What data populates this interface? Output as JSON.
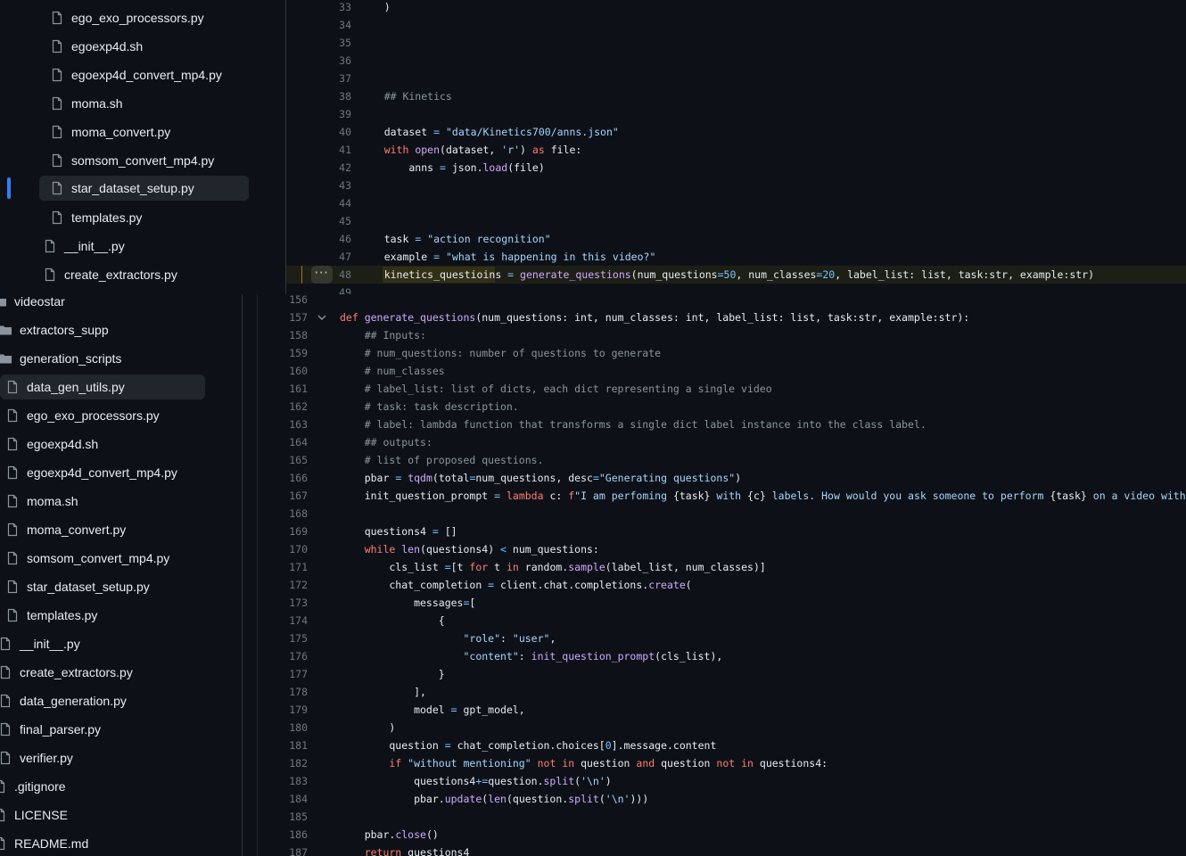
{
  "top_tree": {
    "items": [
      {
        "label": "ego_exo_processors.py",
        "type": "file"
      },
      {
        "label": "egoexp4d.sh",
        "type": "file"
      },
      {
        "label": "egoexp4d_convert_mp4.py",
        "type": "file"
      },
      {
        "label": "moma.sh",
        "type": "file"
      },
      {
        "label": "moma_convert.py",
        "type": "file"
      },
      {
        "label": "somsom_convert_mp4.py",
        "type": "file"
      },
      {
        "label": "star_dataset_setup.py",
        "type": "file"
      },
      {
        "label": "templates.py",
        "type": "file"
      },
      {
        "label": "__init__.py",
        "type": "file"
      },
      {
        "label": "create_extractors.py",
        "type": "file"
      }
    ]
  },
  "bottom_tree": {
    "items": [
      {
        "label": "videostar",
        "type": "folder"
      },
      {
        "label": "extractors_supp",
        "type": "folder"
      },
      {
        "label": "generation_scripts",
        "type": "folder"
      },
      {
        "label": "data_gen_utils.py",
        "type": "file"
      },
      {
        "label": "ego_exo_processors.py",
        "type": "file"
      },
      {
        "label": "egoexp4d.sh",
        "type": "file"
      },
      {
        "label": "egoexp4d_convert_mp4.py",
        "type": "file"
      },
      {
        "label": "moma.sh",
        "type": "file"
      },
      {
        "label": "moma_convert.py",
        "type": "file"
      },
      {
        "label": "somsom_convert_mp4.py",
        "type": "file"
      },
      {
        "label": "star_dataset_setup.py",
        "type": "file"
      },
      {
        "label": "templates.py",
        "type": "file"
      },
      {
        "label": "__init__.py",
        "type": "file"
      },
      {
        "label": "create_extractors.py",
        "type": "file"
      },
      {
        "label": "data_generation.py",
        "type": "file"
      },
      {
        "label": "final_parser.py",
        "type": "file"
      },
      {
        "label": "verifier.py",
        "type": "file"
      },
      {
        "label": ".gitignore",
        "type": "file"
      },
      {
        "label": "LICENSE",
        "type": "file"
      },
      {
        "label": "README.md",
        "type": "file"
      }
    ]
  },
  "top_code": {
    "expand_button": "···",
    "lines": [
      {
        "n": "33",
        "tokens": [
          [
            "",
            "    )"
          ]
        ]
      },
      {
        "n": "34",
        "tokens": []
      },
      {
        "n": "35",
        "tokens": []
      },
      {
        "n": "36",
        "tokens": []
      },
      {
        "n": "37",
        "tokens": []
      },
      {
        "n": "38",
        "tokens": [
          [
            "cm",
            "    ## Kinetics"
          ]
        ]
      },
      {
        "n": "39",
        "tokens": []
      },
      {
        "n": "40",
        "tokens": [
          [
            "",
            "    dataset "
          ],
          [
            "op",
            "="
          ],
          [
            "",
            " "
          ],
          [
            "str",
            "\"data/Kinetics700/anns.json\""
          ]
        ]
      },
      {
        "n": "41",
        "tokens": [
          [
            "kw",
            "    with "
          ],
          [
            "fn",
            "open"
          ],
          [
            "",
            "(dataset, "
          ],
          [
            "str",
            "'r'"
          ],
          [
            "",
            ") "
          ],
          [
            "kw",
            "as"
          ],
          [
            "",
            " file:"
          ]
        ]
      },
      {
        "n": "42",
        "tokens": [
          [
            "",
            "        anns "
          ],
          [
            "op",
            "="
          ],
          [
            "",
            " json."
          ],
          [
            "fn",
            "load"
          ],
          [
            "",
            "(file)"
          ]
        ]
      },
      {
        "n": "43",
        "tokens": []
      },
      {
        "n": "44",
        "tokens": []
      },
      {
        "n": "45",
        "tokens": []
      },
      {
        "n": "46",
        "tokens": [
          [
            "",
            "    task "
          ],
          [
            "op",
            "="
          ],
          [
            "",
            " "
          ],
          [
            "str",
            "\"action recognition\""
          ]
        ]
      },
      {
        "n": "47",
        "tokens": [
          [
            "",
            "    example "
          ],
          [
            "op",
            "="
          ],
          [
            "",
            " "
          ],
          [
            "str",
            "\"what is happening in this video?\""
          ]
        ]
      },
      {
        "n": "48",
        "tokens": [
          [
            "",
            "    kinetics_questioins "
          ],
          [
            "op",
            "="
          ],
          [
            "",
            " "
          ],
          [
            "fn",
            "generate_questions"
          ],
          [
            "",
            "(num_questions"
          ],
          [
            "op",
            "="
          ],
          [
            "num",
            "50"
          ],
          [
            "",
            ", num_classes"
          ],
          [
            "op",
            "="
          ],
          [
            "num",
            "20"
          ],
          [
            "",
            ", label_list: list, task:str, example:str)"
          ]
        ]
      },
      {
        "n": "49",
        "tokens": []
      }
    ]
  },
  "bottom_code": {
    "lines": [
      {
        "n": "156",
        "tokens": []
      },
      {
        "n": "157",
        "tokens": [
          [
            "kw",
            "def "
          ],
          [
            "fn",
            "generate_questions"
          ],
          [
            "",
            "(num_questions: int, num_classes: int, label_list: list, task:str, example:str):"
          ]
        ]
      },
      {
        "n": "158",
        "tokens": [
          [
            "cm",
            "    ## Inputs:"
          ]
        ]
      },
      {
        "n": "159",
        "tokens": [
          [
            "cm",
            "    # num_questions: number of questions to generate"
          ]
        ]
      },
      {
        "n": "160",
        "tokens": [
          [
            "cm",
            "    # num_classes"
          ]
        ]
      },
      {
        "n": "161",
        "tokens": [
          [
            "cm",
            "    # label_list: list of dicts, each dict representing a single video"
          ]
        ]
      },
      {
        "n": "162",
        "tokens": [
          [
            "cm",
            "    # task: task description."
          ]
        ]
      },
      {
        "n": "163",
        "tokens": [
          [
            "cm",
            "    # label: lambda function that transforms a single dict label instance into the class label."
          ]
        ]
      },
      {
        "n": "164",
        "tokens": [
          [
            "cm",
            "    ## outputs:"
          ]
        ]
      },
      {
        "n": "165",
        "tokens": [
          [
            "cm",
            "    # list of proposed questions."
          ]
        ]
      },
      {
        "n": "166",
        "tokens": [
          [
            "",
            "    pbar "
          ],
          [
            "op",
            "="
          ],
          [
            "",
            " "
          ],
          [
            "fn",
            "tqdm"
          ],
          [
            "",
            "(total"
          ],
          [
            "op",
            "="
          ],
          [
            "",
            "num_questions, desc"
          ],
          [
            "op",
            "="
          ],
          [
            "str",
            "\"Generating questions\""
          ],
          [
            "",
            ")"
          ]
        ]
      },
      {
        "n": "167",
        "tokens": [
          [
            "",
            "    init_question_prompt "
          ],
          [
            "op",
            "="
          ],
          [
            "",
            " "
          ],
          [
            "kw",
            "lambda"
          ],
          [
            "",
            " c: "
          ],
          [
            "kw",
            "f"
          ],
          [
            "str",
            "\"I am perfoming "
          ],
          [
            "",
            "{task}"
          ],
          [
            "str",
            " with "
          ],
          [
            "",
            "{c}"
          ],
          [
            "str",
            " labels. How would you ask someone to perform "
          ],
          [
            "",
            "{task}"
          ],
          [
            "str",
            " on a video without mentioning"
          ]
        ]
      },
      {
        "n": "168",
        "tokens": []
      },
      {
        "n": "169",
        "tokens": [
          [
            "",
            "    questions4 "
          ],
          [
            "op",
            "="
          ],
          [
            "",
            " []"
          ]
        ]
      },
      {
        "n": "170",
        "tokens": [
          [
            "kw",
            "    while "
          ],
          [
            "fn",
            "len"
          ],
          [
            "",
            "(questions4) "
          ],
          [
            "op",
            "<"
          ],
          [
            "",
            " num_questions:"
          ]
        ]
      },
      {
        "n": "171",
        "tokens": [
          [
            "",
            "        cls_list "
          ],
          [
            "op",
            "="
          ],
          [
            "",
            "[t "
          ],
          [
            "kw",
            "for"
          ],
          [
            "",
            " t "
          ],
          [
            "kw",
            "in"
          ],
          [
            "",
            " random."
          ],
          [
            "fn",
            "sample"
          ],
          [
            "",
            "(label_list, num_classes)]"
          ]
        ]
      },
      {
        "n": "172",
        "tokens": [
          [
            "",
            "        chat_completion "
          ],
          [
            "op",
            "="
          ],
          [
            "",
            " client.chat.completions."
          ],
          [
            "fn",
            "create"
          ],
          [
            "",
            "("
          ]
        ]
      },
      {
        "n": "173",
        "tokens": [
          [
            "",
            "            messages"
          ],
          [
            "op",
            "="
          ],
          [
            "",
            "["
          ]
        ]
      },
      {
        "n": "174",
        "tokens": [
          [
            "",
            "                {"
          ]
        ]
      },
      {
        "n": "175",
        "tokens": [
          [
            "",
            "                    "
          ],
          [
            "str",
            "\"role\""
          ],
          [
            "",
            ": "
          ],
          [
            "str",
            "\"user\""
          ],
          [
            "",
            ","
          ]
        ]
      },
      {
        "n": "176",
        "tokens": [
          [
            "",
            "                    "
          ],
          [
            "str",
            "\"content\""
          ],
          [
            "",
            ": "
          ],
          [
            "fn",
            "init_question_prompt"
          ],
          [
            "",
            "(cls_list),"
          ]
        ]
      },
      {
        "n": "177",
        "tokens": [
          [
            "",
            "                }"
          ]
        ]
      },
      {
        "n": "178",
        "tokens": [
          [
            "",
            "            ],"
          ]
        ]
      },
      {
        "n": "179",
        "tokens": [
          [
            "",
            "            model "
          ],
          [
            "op",
            "="
          ],
          [
            "",
            " gpt_model,"
          ]
        ]
      },
      {
        "n": "180",
        "tokens": [
          [
            "",
            "        )"
          ]
        ]
      },
      {
        "n": "181",
        "tokens": [
          [
            "",
            "        question "
          ],
          [
            "op",
            "="
          ],
          [
            "",
            " chat_completion.choices["
          ],
          [
            "num",
            "0"
          ],
          [
            "",
            "].message.content"
          ]
        ]
      },
      {
        "n": "182",
        "tokens": [
          [
            "kw",
            "        if "
          ],
          [
            "str",
            "\"without mentioning\""
          ],
          [
            "",
            " "
          ],
          [
            "kw",
            "not in"
          ],
          [
            "",
            " question "
          ],
          [
            "kw",
            "and"
          ],
          [
            "",
            " question "
          ],
          [
            "kw",
            "not in"
          ],
          [
            "",
            " questions4:"
          ]
        ]
      },
      {
        "n": "183",
        "tokens": [
          [
            "",
            "            questions4"
          ],
          [
            "op",
            "+="
          ],
          [
            "",
            "question."
          ],
          [
            "fn",
            "split"
          ],
          [
            "",
            "("
          ],
          [
            "str",
            "'\\n'"
          ],
          [
            "",
            ")"
          ]
        ]
      },
      {
        "n": "184",
        "tokens": [
          [
            "",
            "            pbar."
          ],
          [
            "fn",
            "update"
          ],
          [
            "",
            "("
          ],
          [
            "fn",
            "len"
          ],
          [
            "",
            "(question."
          ],
          [
            "fn",
            "split"
          ],
          [
            "",
            "("
          ],
          [
            "str",
            "'\\n'"
          ],
          [
            "",
            ")))"
          ]
        ]
      },
      {
        "n": "185",
        "tokens": []
      },
      {
        "n": "186",
        "tokens": [
          [
            "",
            "    pbar."
          ],
          [
            "fn",
            "close"
          ],
          [
            "",
            "()"
          ]
        ]
      },
      {
        "n": "187",
        "tokens": [
          [
            "kw",
            "    return"
          ],
          [
            "",
            " questions4"
          ]
        ]
      }
    ]
  }
}
